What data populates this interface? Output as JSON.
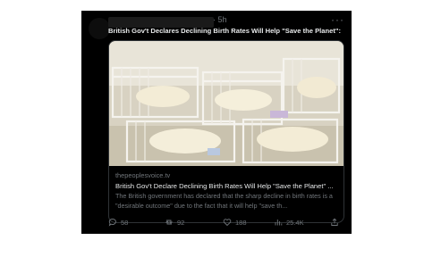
{
  "post": {
    "timestamp": "· 5h",
    "more_label": "···",
    "text": "British Gov't Declares Declining Birth Rates Will Help \"Save the Planet\":"
  },
  "card": {
    "domain": "thepeoplesvoice.tv",
    "title": "British Gov't Declare Declining Birth Rates Will Help \"Save the Planet\" ...",
    "description": "The British government has declared that the sharp decline in birth rates is a \"desirable outcome\" due to the fact that it will help \"save th..."
  },
  "actions": {
    "replies": "58",
    "reposts": "92",
    "likes": "188",
    "views": "25.4K"
  }
}
